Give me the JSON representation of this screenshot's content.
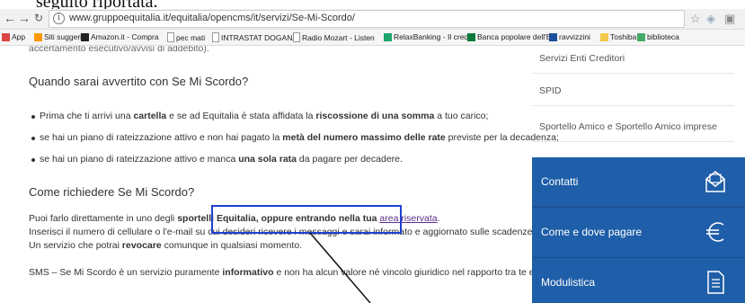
{
  "caption": "seguito riportata.",
  "browser": {
    "url": "www.gruppoequitalia.it/equitalia/opencms/it/servizi/Se-Mi-Scordo/",
    "bookmarks": [
      {
        "label": "App",
        "icon": "apps-grid-icon",
        "color": "#d44"
      },
      {
        "label": "Siti suggeriti",
        "icon": "bookmark-icon",
        "color": "#ff9800"
      },
      {
        "label": "Amazon.it - Compra",
        "icon": "amazon-icon",
        "color": "#222"
      },
      {
        "label": "pec mati",
        "icon": "page-icon",
        "color": "#999"
      },
      {
        "label": "INTRASTAT DOGANA",
        "icon": "page-icon",
        "color": "#999"
      },
      {
        "label": "Radio Mozart - Listen",
        "icon": "page-icon",
        "color": "#999"
      },
      {
        "label": "RelaxBanking - Il cred",
        "icon": "bank-icon",
        "color": "#1aa36b"
      },
      {
        "label": "Banca popolare dell'E",
        "icon": "bank-icon",
        "color": "#0a7a3a"
      },
      {
        "label": "ravvizzini",
        "icon": "cloud-icon",
        "color": "#1e4f9a"
      },
      {
        "label": "Toshiba",
        "icon": "folder-icon",
        "color": "#f2c94c"
      },
      {
        "label": "biblioteca",
        "icon": "barcode-icon",
        "color": "#4a6"
      }
    ]
  },
  "main": {
    "truncated_line": "accertamento esecutivo/avvisi di addebito).",
    "h_quando": "Quando sarai avvertito con Se Mi Scordo?",
    "bullets": [
      {
        "pre": "Prima che ti arrivi una ",
        "b1": "cartella",
        "mid": " e se ad Equitalia è stata affidata la ",
        "b2": "riscossione di una somma",
        "post": " a tuo carico;"
      },
      {
        "pre": "se hai un piano di rateizzazione attivo e non hai pagato la ",
        "b1": "metà del numero massimo delle rate",
        "mid": " previste per la decadenza;",
        "b2": "",
        "post": ""
      },
      {
        "pre": "se hai un piano di rateizzazione attivo e manca ",
        "b1": "una sola rata",
        "mid": " da pagare per decadere.",
        "b2": "",
        "post": ""
      }
    ],
    "h_come": "Come richiedere Se Mi Scordo?",
    "p1_pre": "Puoi farlo direttamente in uno degli ",
    "p1_bold": "sportelli Equitalia, oppure entrando nella tua ",
    "p1_link": "area riservata",
    "p1_post": ".",
    "p2": "Inserisci il numero di cellulare o l'e-mail su cui desideri ricevere i messaggi e sarai informato e aggiornato sulle scadenze.",
    "p3_pre": "Un servizio che potrai ",
    "p3_bold": "revocare",
    "p3_post": " comunque in qualsiasi momento.",
    "p4_pre": "SMS – Se Mi Scordo è un servizio puramente ",
    "p4_bold": "informativo",
    "p4_post": " e non ha alcun valore né vincolo giuridico nel rapporto tra te ed Equitalia."
  },
  "sidebar": {
    "links": [
      "Servizi Enti Creditori",
      "SPID",
      "Sportello Amico e Sportello Amico imprese"
    ],
    "buttons": [
      {
        "label": "Contatti",
        "icon": "envelope-icon"
      },
      {
        "label": "Come e dove pagare",
        "icon": "euro-icon"
      },
      {
        "label": "Modulistica",
        "icon": "document-icon"
      }
    ],
    "blue": "#1f5ea8"
  }
}
